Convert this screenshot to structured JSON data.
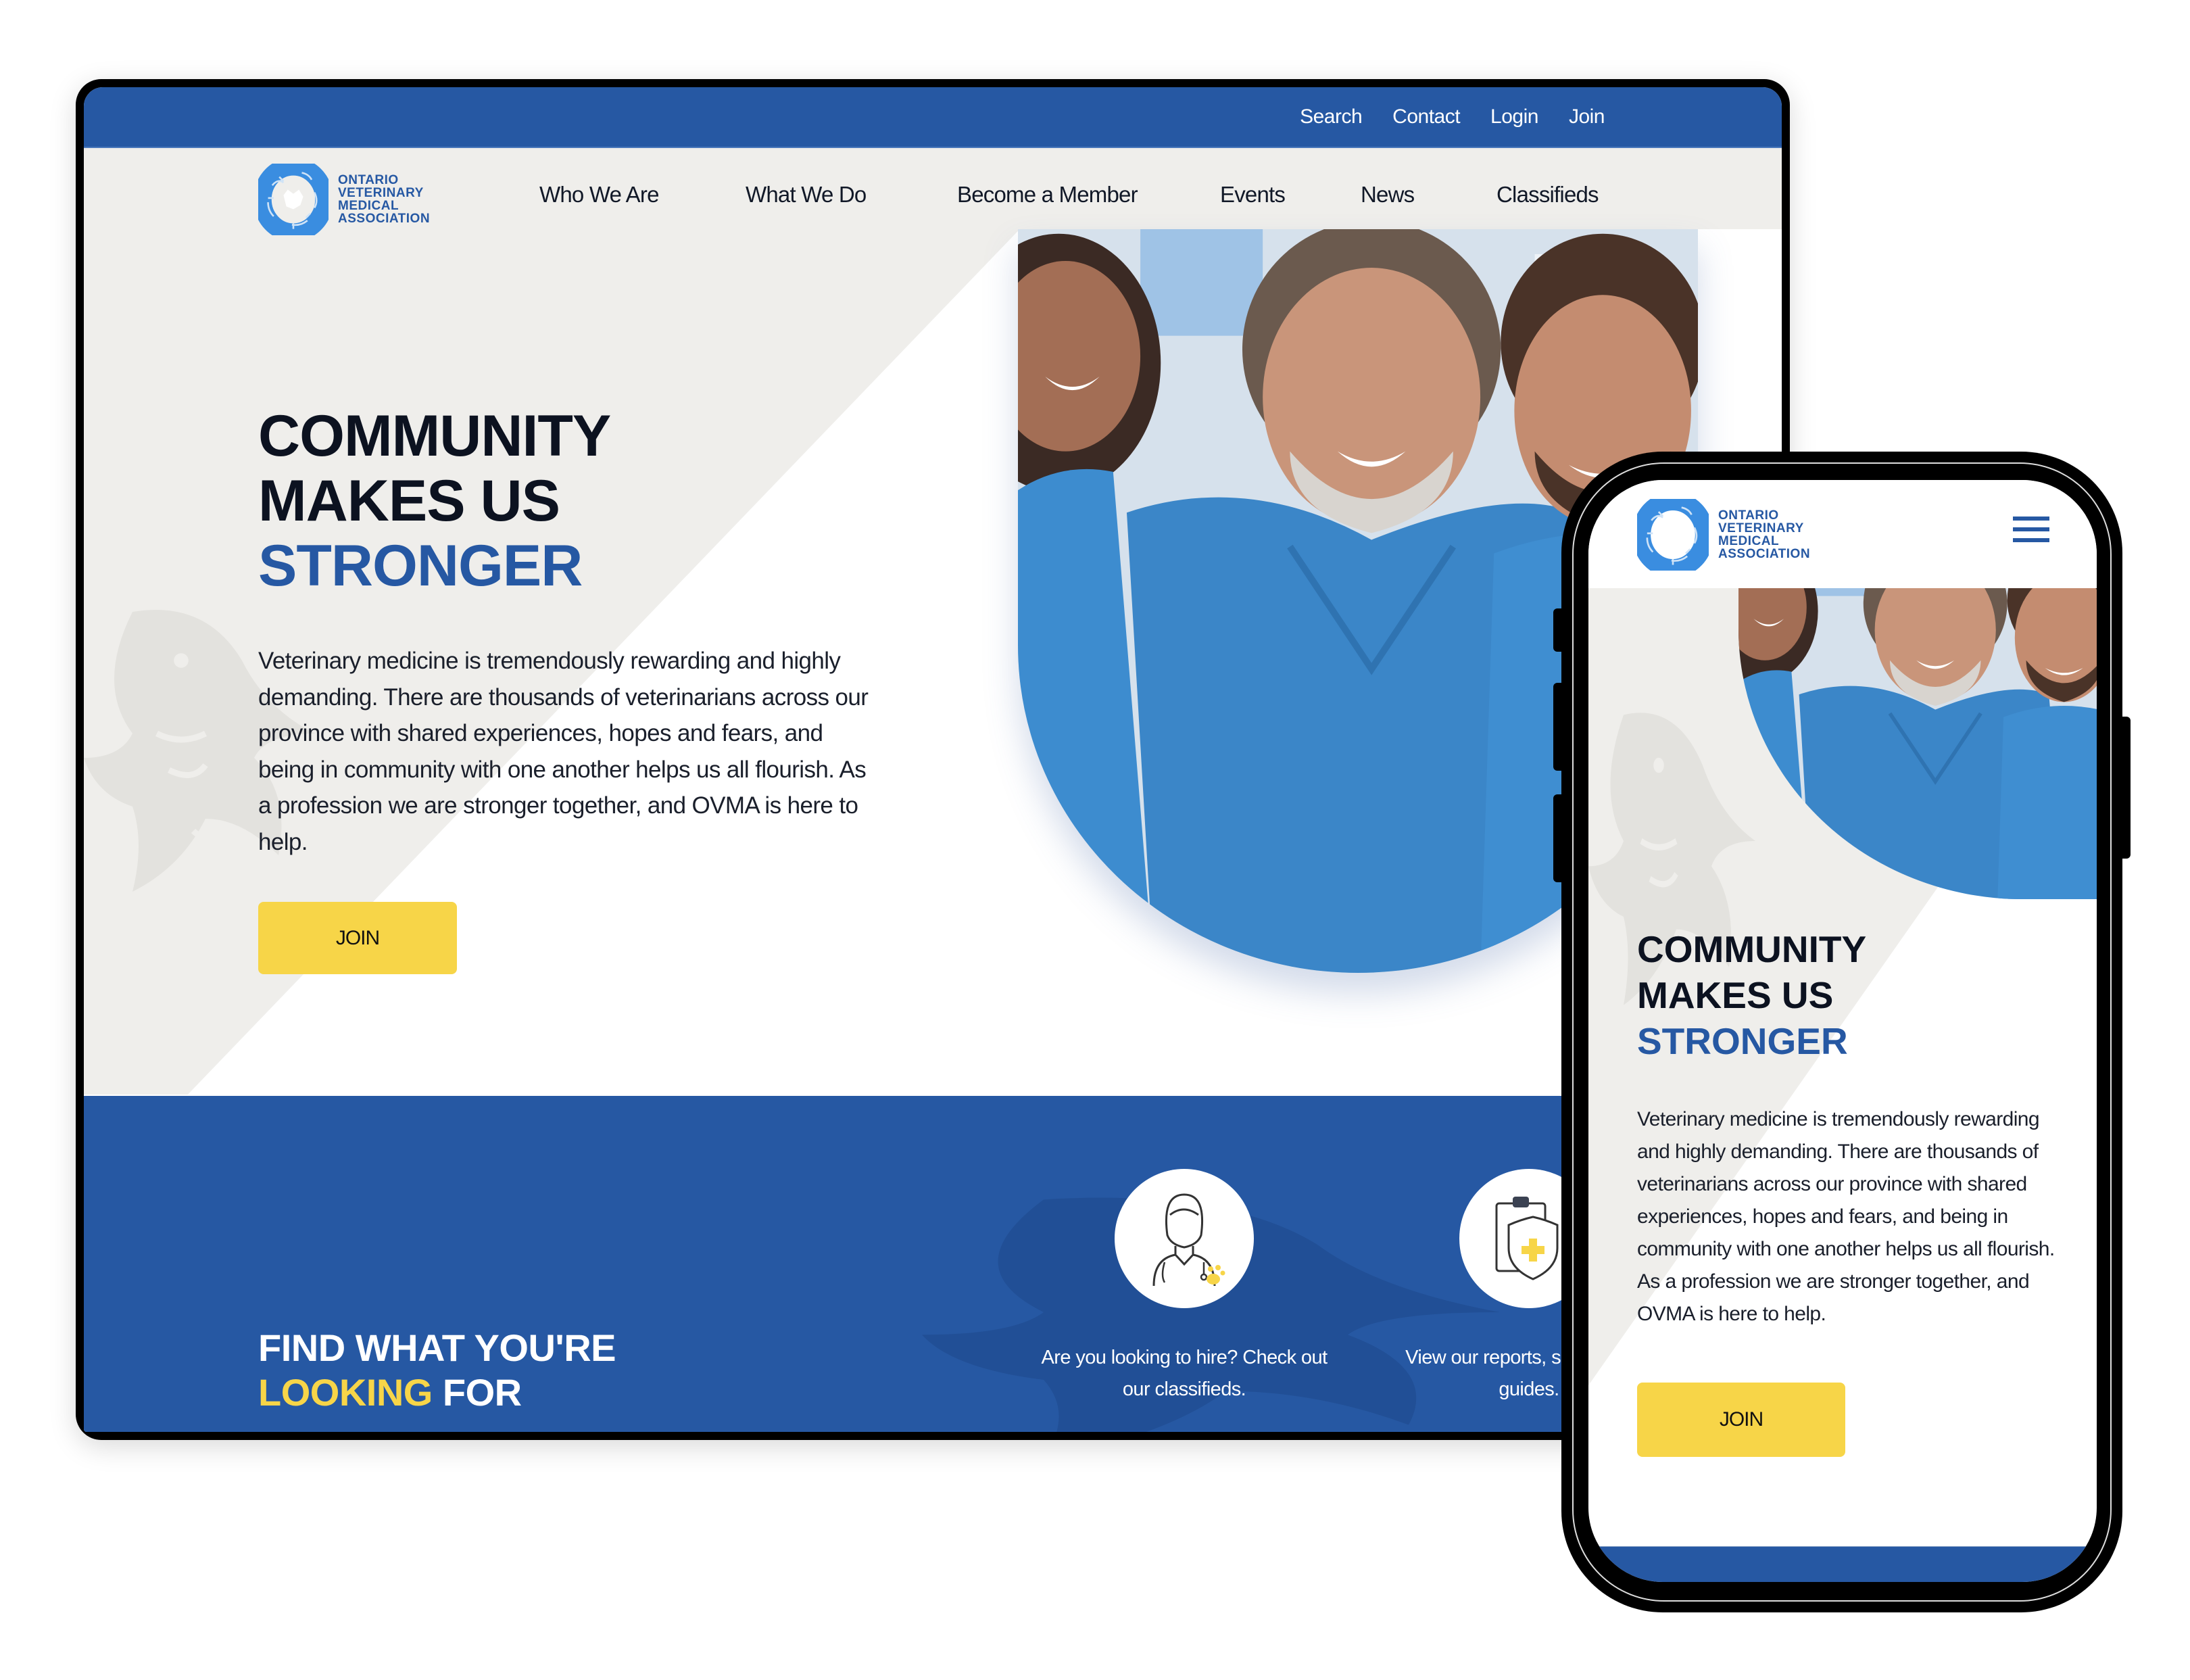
{
  "brand": {
    "logo_lines": [
      "ONTARIO",
      "VETERINARY",
      "MEDICAL",
      "ASSOCIATION"
    ],
    "colors": {
      "primary_blue": "#2658a3",
      "accent_yellow": "#f7d548",
      "hero_grey": "#efeeeb",
      "text_dark": "#0c1220"
    }
  },
  "desktop": {
    "utility_nav": [
      "Search",
      "Contact",
      "Login",
      "Join"
    ],
    "main_nav": [
      "Who We Are",
      "What We Do",
      "Become a Member",
      "Events",
      "News",
      "Classifieds"
    ],
    "hero": {
      "title_line1": "COMMUNITY",
      "title_line2": "MAKES US",
      "title_accent": "STRONGER",
      "body": "Veterinary medicine is tremendously rewarding and highly demanding. There are thousands of veterinarians across our province with shared experiences, hopes and fears, and being in community with one another helps us all flourish. As a profession we are stronger together, and OVMA is here to help.",
      "cta_label": "JOIN",
      "image_alt": "three-smiling-veterinarians-in-blue-scrubs"
    },
    "find_section": {
      "title_line1": "FIND WHAT YOU'RE",
      "title_accent": "LOOKING",
      "title_rest": "FOR",
      "features": [
        {
          "icon": "veterinarian-icon",
          "text": "Are you looking to hire? Check out our classifieds."
        },
        {
          "icon": "clipboard-shield-icon",
          "text": "View our reports, surveys and guides."
        }
      ]
    }
  },
  "mobile": {
    "menu_icon": "hamburger-menu-icon",
    "hero": {
      "title_line1": "COMMUNITY",
      "title_line2": "MAKES US",
      "title_accent": "STRONGER",
      "body": "Veterinary medicine is tremendously rewarding and highly demanding. There are thousands of veterinarians across our province with shared experiences, hopes and fears, and being in community with one another helps us all flourish. As a profession we are stronger together, and OVMA is here to help.",
      "cta_label": "JOIN"
    }
  }
}
